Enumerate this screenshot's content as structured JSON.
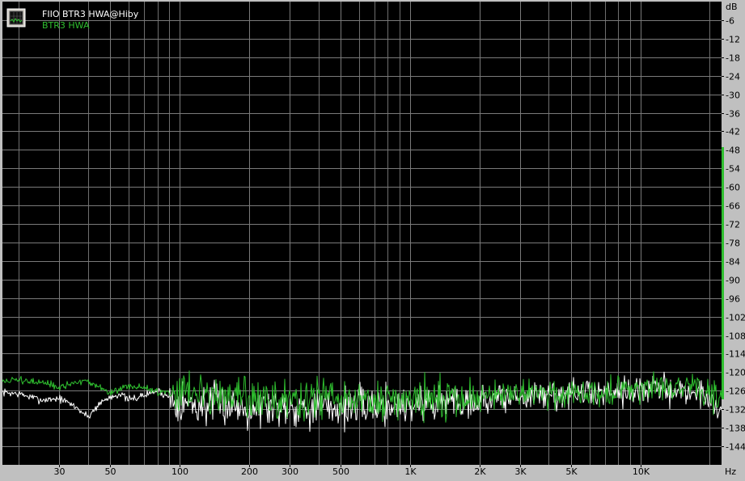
{
  "chart_data": {
    "type": "line",
    "title": "",
    "x_scale": "log",
    "xlim": [
      17,
      22500
    ],
    "ylim": [
      -150,
      0
    ],
    "grid": true,
    "legend_position": "top-left",
    "y_unit_label": "dB",
    "x_unit_label": "Hz",
    "y_ticks": [
      {
        "value": -6,
        "label": "-6"
      },
      {
        "value": -12,
        "label": "-12"
      },
      {
        "value": -18,
        "label": "-18"
      },
      {
        "value": -24,
        "label": "-24"
      },
      {
        "value": -30,
        "label": "-30"
      },
      {
        "value": -36,
        "label": "-36"
      },
      {
        "value": -42,
        "label": "-42"
      },
      {
        "value": -48,
        "label": "-48"
      },
      {
        "value": -54,
        "label": "-54"
      },
      {
        "value": -60,
        "label": "-60"
      },
      {
        "value": -66,
        "label": "-66"
      },
      {
        "value": -72,
        "label": "-72"
      },
      {
        "value": -78,
        "label": "-78"
      },
      {
        "value": -84,
        "label": "-84"
      },
      {
        "value": -90,
        "label": "-90"
      },
      {
        "value": -96,
        "label": "-96"
      },
      {
        "value": -102,
        "label": "-102"
      },
      {
        "value": -108,
        "label": "-108"
      },
      {
        "value": -114,
        "label": "-114"
      },
      {
        "value": -120,
        "label": "-120"
      },
      {
        "value": -126,
        "label": "-126"
      },
      {
        "value": -132,
        "label": "-132"
      },
      {
        "value": -138,
        "label": "-138"
      },
      {
        "value": -144,
        "label": "-144"
      }
    ],
    "x_ticks": [
      {
        "value": 30,
        "label": "30"
      },
      {
        "value": 50,
        "label": "50"
      },
      {
        "value": 100,
        "label": "100"
      },
      {
        "value": 200,
        "label": "200"
      },
      {
        "value": 300,
        "label": "300"
      },
      {
        "value": 500,
        "label": "500"
      },
      {
        "value": 1000,
        "label": "1K"
      },
      {
        "value": 2000,
        "label": "2K"
      },
      {
        "value": 3000,
        "label": "3K"
      },
      {
        "value": 5000,
        "label": "5K"
      },
      {
        "value": 10000,
        "label": "10K"
      }
    ],
    "x_minor_grid": [
      20,
      40,
      60,
      70,
      80,
      90,
      400,
      600,
      700,
      800,
      900,
      4000,
      6000,
      7000,
      8000,
      9000,
      20000
    ],
    "series": [
      {
        "name": "FIIO BTR3 HWA@Hiby",
        "color": "#ffffff",
        "x": [
          17,
          20,
          25,
          30,
          35,
          40,
          45,
          50,
          55,
          60,
          70,
          80,
          90,
          100,
          120,
          150,
          200,
          250,
          300,
          400,
          500,
          700,
          1000,
          1500,
          2000,
          3000,
          5000,
          7000,
          8000,
          10000,
          12000,
          15000,
          18000,
          20000,
          21500,
          22500
        ],
        "y": [
          -126.5,
          -127,
          -129,
          -128.5,
          -131,
          -134.5,
          -130,
          -128,
          -127,
          -129,
          -127.5,
          -126,
          -128,
          -129.5,
          -131,
          -130,
          -131.5,
          -131,
          -131,
          -131.5,
          -131.5,
          -130.5,
          -130.5,
          -129,
          -129,
          -128,
          -127,
          -126.5,
          -125.5,
          -126,
          -125.5,
          -126,
          -127,
          -128,
          -131,
          -133
        ]
      },
      {
        "name": "BTR3 HWA",
        "color": "#2fbf2f",
        "x": [
          17,
          20,
          25,
          30,
          35,
          40,
          45,
          50,
          55,
          60,
          70,
          80,
          90,
          100,
          120,
          150,
          200,
          250,
          300,
          400,
          500,
          700,
          1000,
          1500,
          2000,
          3000,
          5000,
          7000,
          8000,
          10000,
          12000,
          15000,
          18000,
          20000,
          21500,
          22500
        ],
        "y": [
          -123,
          -122.5,
          -123.5,
          -125,
          -123.5,
          -123,
          -125,
          -127,
          -125,
          -124.5,
          -125,
          -126.5,
          -126,
          -125,
          -126,
          -127,
          -129,
          -129,
          -129,
          -129,
          -129.5,
          -129.5,
          -129,
          -128.5,
          -128,
          -127.5,
          -126.5,
          -126,
          -125.5,
          -125,
          -124.5,
          -125,
          -125.5,
          -127,
          -129,
          -131
        ]
      }
    ]
  }
}
